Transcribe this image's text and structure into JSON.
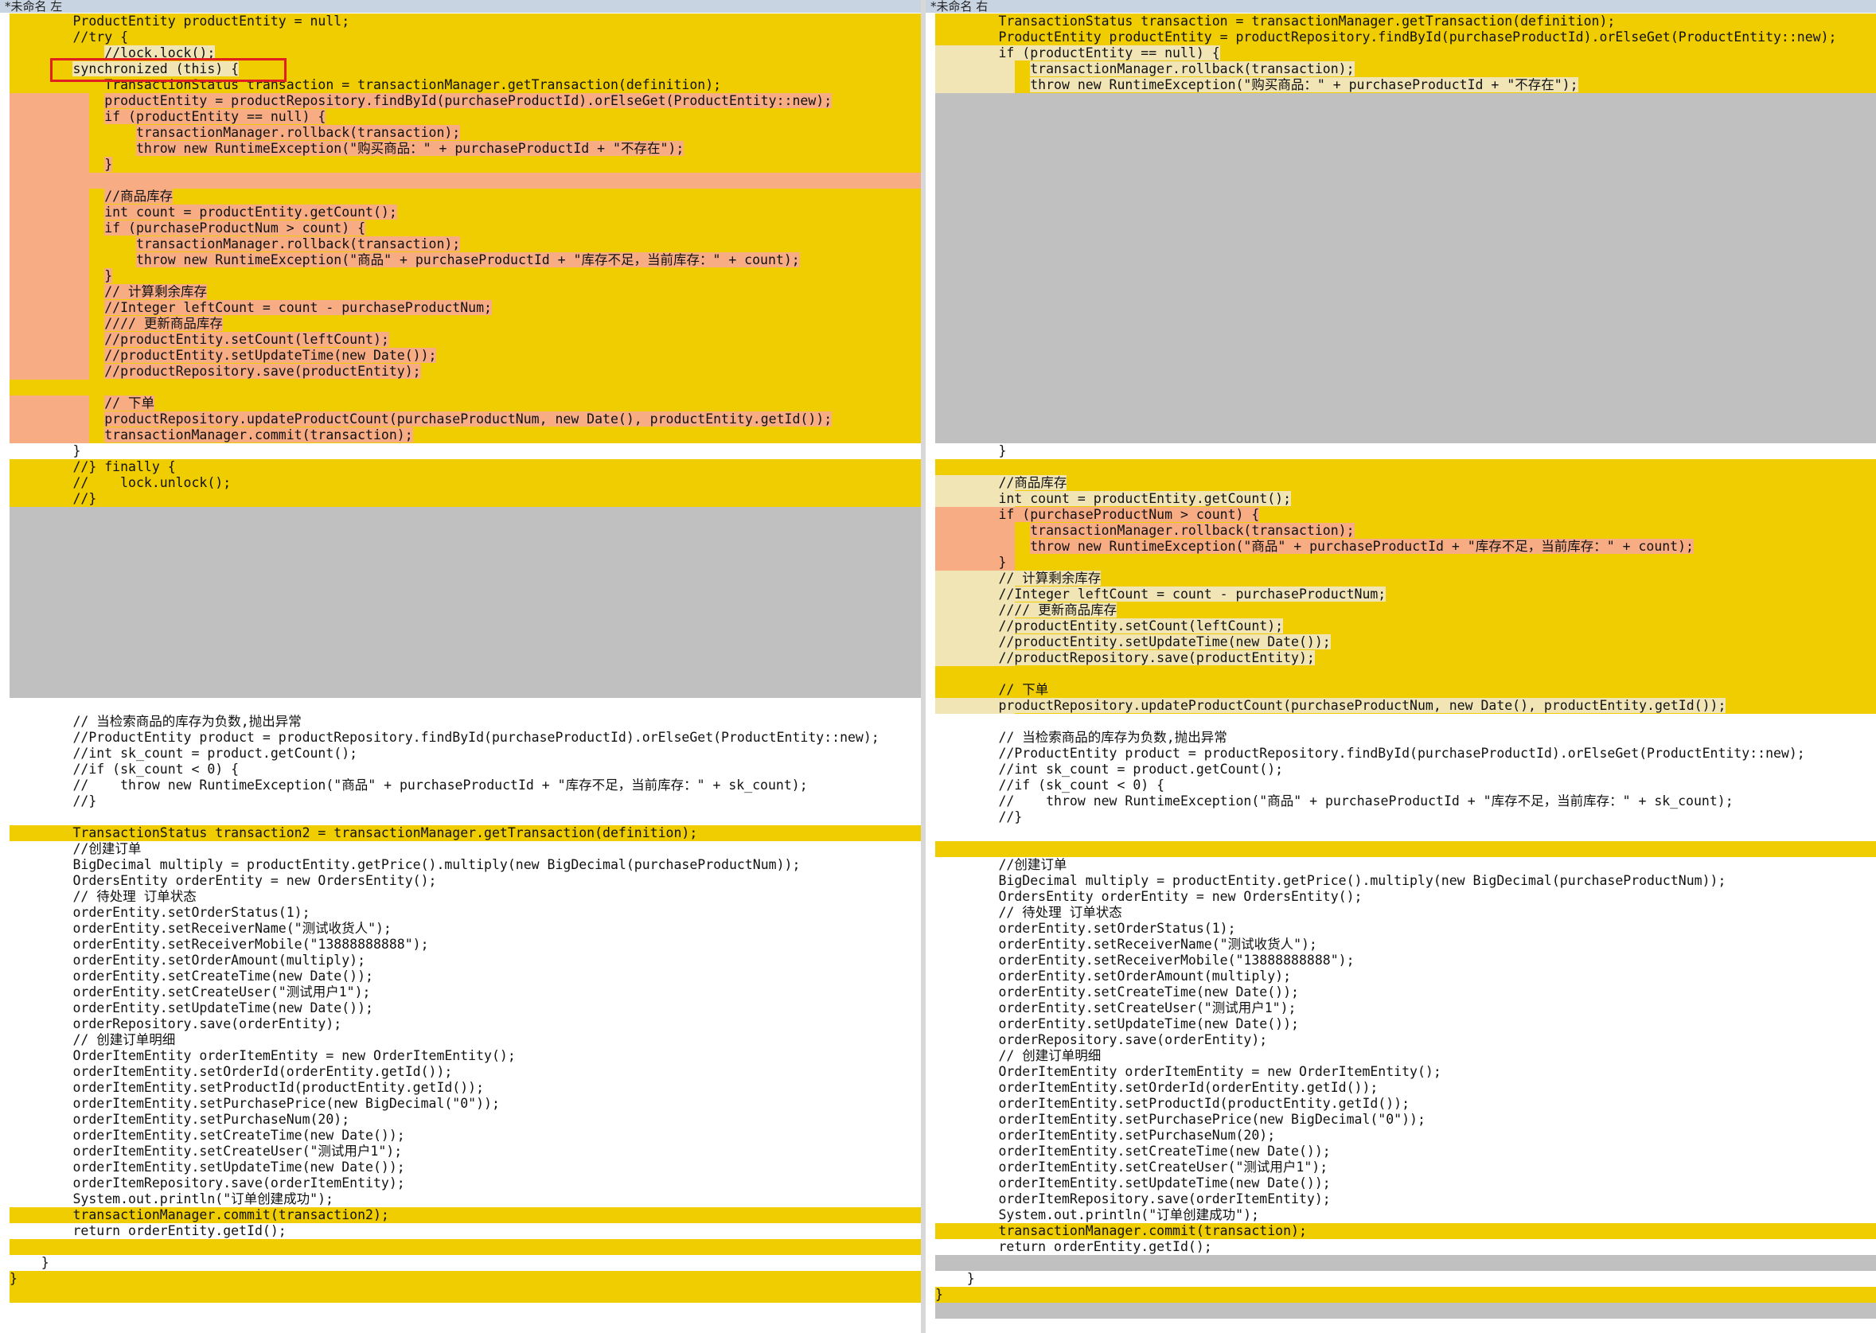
{
  "left_pane": {
    "title": "*未命名 左",
    "lines": [
      {
        "t": "        ProductEntity productEntity = null;",
        "k": "diff"
      },
      {
        "t": "        //try {",
        "k": "diff"
      },
      {
        "t": "            //lock.lock();",
        "k": "diff",
        "light": true
      },
      {
        "t": "        synchronized (this) {",
        "k": "diff",
        "light": true
      },
      {
        "t": "            TransactionStatus transaction = transactionManager.getTransaction(definition);",
        "k": "diff"
      },
      {
        "t": "            productEntity = productRepository.findById(purchaseProductId).orElseGet(ProductEntity::new);",
        "k": "diff",
        "strong": true
      },
      {
        "t": "            if (productEntity == null) {",
        "k": "diff",
        "strong": true
      },
      {
        "t": "                transactionManager.rollback(transaction);",
        "k": "diff",
        "strong": true
      },
      {
        "t": "                throw new RuntimeException(\"购买商品：\" + purchaseProductId + \"不存在\");",
        "k": "diff",
        "strong": true
      },
      {
        "t": "            }",
        "k": "diff",
        "strong": true
      },
      {
        "t": "",
        "k": "diff",
        "strong": true
      },
      {
        "t": "            //商品库存",
        "k": "diff",
        "strong": true
      },
      {
        "t": "            int count = productEntity.getCount();",
        "k": "diff",
        "strong": true
      },
      {
        "t": "            if (purchaseProductNum > count) {",
        "k": "diff",
        "strong": true
      },
      {
        "t": "                transactionManager.rollback(transaction);",
        "k": "diff",
        "strong": true
      },
      {
        "t": "                throw new RuntimeException(\"商品\" + purchaseProductId + \"库存不足，当前库存：\" + count);",
        "k": "diff",
        "strong": true
      },
      {
        "t": "            }",
        "k": "diff",
        "strong": true
      },
      {
        "t": "            // 计算剩余库存",
        "k": "diff",
        "strong": true
      },
      {
        "t": "            //Integer leftCount = count - purchaseProductNum;",
        "k": "diff",
        "strong": true
      },
      {
        "t": "            //// 更新商品库存",
        "k": "diff",
        "strong": true
      },
      {
        "t": "            //productEntity.setCount(leftCount);",
        "k": "diff",
        "strong": true
      },
      {
        "t": "            //productEntity.setUpdateTime(new Date());",
        "k": "diff",
        "strong": true
      },
      {
        "t": "            //productRepository.save(productEntity);",
        "k": "diff",
        "strong": true
      },
      {
        "t": "",
        "k": "diff",
        "light": true
      },
      {
        "t": "            // 下单",
        "k": "diff",
        "strong": true
      },
      {
        "t": "            productRepository.updateProductCount(purchaseProductNum, new Date(), productEntity.getId());",
        "k": "diff",
        "strong": true
      },
      {
        "t": "            transactionManager.commit(transaction);",
        "k": "diff",
        "strong": true
      },
      {
        "t": "        }",
        "k": "plain"
      },
      {
        "t": "        //} finally {",
        "k": "diff"
      },
      {
        "t": "        //    lock.unlock();",
        "k": "diff"
      },
      {
        "t": "        //}",
        "k": "diff"
      },
      {
        "t": "",
        "k": "gap"
      },
      {
        "t": "",
        "k": "gap"
      },
      {
        "t": "",
        "k": "gap"
      },
      {
        "t": "",
        "k": "gap"
      },
      {
        "t": "",
        "k": "gap"
      },
      {
        "t": "",
        "k": "gap"
      },
      {
        "t": "",
        "k": "gap"
      },
      {
        "t": "",
        "k": "gap"
      },
      {
        "t": "",
        "k": "gap"
      },
      {
        "t": "",
        "k": "gap"
      },
      {
        "t": "",
        "k": "gap"
      },
      {
        "t": "",
        "k": "gap"
      },
      {
        "t": "",
        "k": "plain"
      },
      {
        "t": "        // 当检索商品的库存为负数,抛出异常",
        "k": "plain"
      },
      {
        "t": "        //ProductEntity product = productRepository.findById(purchaseProductId).orElseGet(ProductEntity::new);",
        "k": "plain"
      },
      {
        "t": "        //int sk_count = product.getCount();",
        "k": "plain"
      },
      {
        "t": "        //if (sk_count < 0) {",
        "k": "plain"
      },
      {
        "t": "        //    throw new RuntimeException(\"商品\" + purchaseProductId + \"库存不足，当前库存：\" + sk_count);",
        "k": "plain"
      },
      {
        "t": "        //}",
        "k": "plain"
      },
      {
        "t": "",
        "k": "plain"
      },
      {
        "t": "        TransactionStatus transaction2 = transactionManager.getTransaction(definition);",
        "k": "diff"
      },
      {
        "t": "        //创建订单",
        "k": "plain"
      },
      {
        "t": "        BigDecimal multiply = productEntity.getPrice().multiply(new BigDecimal(purchaseProductNum));",
        "k": "plain"
      },
      {
        "t": "        OrdersEntity orderEntity = new OrdersEntity();",
        "k": "plain"
      },
      {
        "t": "        // 待处理 订单状态",
        "k": "plain"
      },
      {
        "t": "        orderEntity.setOrderStatus(1);",
        "k": "plain"
      },
      {
        "t": "        orderEntity.setReceiverName(\"测试收货人\");",
        "k": "plain"
      },
      {
        "t": "        orderEntity.setReceiverMobile(\"13888888888\");",
        "k": "plain"
      },
      {
        "t": "        orderEntity.setOrderAmount(multiply);",
        "k": "plain"
      },
      {
        "t": "        orderEntity.setCreateTime(new Date());",
        "k": "plain"
      },
      {
        "t": "        orderEntity.setCreateUser(\"测试用户1\");",
        "k": "plain"
      },
      {
        "t": "        orderEntity.setUpdateTime(new Date());",
        "k": "plain"
      },
      {
        "t": "        orderRepository.save(orderEntity);",
        "k": "plain"
      },
      {
        "t": "        // 创建订单明细",
        "k": "plain"
      },
      {
        "t": "        OrderItemEntity orderItemEntity = new OrderItemEntity();",
        "k": "plain"
      },
      {
        "t": "        orderItemEntity.setOrderId(orderEntity.getId());",
        "k": "plain"
      },
      {
        "t": "        orderItemEntity.setProductId(productEntity.getId());",
        "k": "plain"
      },
      {
        "t": "        orderItemEntity.setPurchasePrice(new BigDecimal(\"0\"));",
        "k": "plain"
      },
      {
        "t": "        orderItemEntity.setPurchaseNum(20);",
        "k": "plain"
      },
      {
        "t": "        orderItemEntity.setCreateTime(new Date());",
        "k": "plain"
      },
      {
        "t": "        orderItemEntity.setCreateUser(\"测试用户1\");",
        "k": "plain"
      },
      {
        "t": "        orderItemEntity.setUpdateTime(new Date());",
        "k": "plain"
      },
      {
        "t": "        orderItemRepository.save(orderItemEntity);",
        "k": "plain"
      },
      {
        "t": "        System.out.println(\"订单创建成功\");",
        "k": "plain"
      },
      {
        "t": "        transactionManager.commit(transaction2);",
        "k": "diff"
      },
      {
        "t": "        return orderEntity.getId();",
        "k": "plain"
      },
      {
        "t": "",
        "k": "diff"
      },
      {
        "t": "    }",
        "k": "plain"
      },
      {
        "t": "}",
        "k": "diff"
      },
      {
        "t": "",
        "k": "diff"
      }
    ]
  },
  "right_pane": {
    "title": "*未命名 右",
    "lines": [
      {
        "t": "        TransactionStatus transaction = transactionManager.getTransaction(definition);",
        "k": "diff"
      },
      {
        "t": "        ProductEntity productEntity = productRepository.findById(purchaseProductId).orElseGet(ProductEntity::new);",
        "k": "diff"
      },
      {
        "t": "        if (productEntity == null) {",
        "k": "diff",
        "light": true
      },
      {
        "t": "            transactionManager.rollback(transaction);",
        "k": "diff",
        "light": true
      },
      {
        "t": "            throw new RuntimeException(\"购买商品：\" + purchaseProductId + \"不存在\");",
        "k": "diff",
        "light": true
      },
      {
        "t": "",
        "k": "gap"
      },
      {
        "t": "",
        "k": "gap"
      },
      {
        "t": "",
        "k": "gap"
      },
      {
        "t": "",
        "k": "gap"
      },
      {
        "t": "",
        "k": "gap"
      },
      {
        "t": "",
        "k": "gap"
      },
      {
        "t": "",
        "k": "gap"
      },
      {
        "t": "",
        "k": "gap"
      },
      {
        "t": "",
        "k": "gap"
      },
      {
        "t": "",
        "k": "gap"
      },
      {
        "t": "",
        "k": "gap"
      },
      {
        "t": "",
        "k": "gap"
      },
      {
        "t": "",
        "k": "gap"
      },
      {
        "t": "",
        "k": "gap"
      },
      {
        "t": "",
        "k": "gap"
      },
      {
        "t": "",
        "k": "gap"
      },
      {
        "t": "",
        "k": "gap"
      },
      {
        "t": "",
        "k": "gap"
      },
      {
        "t": "",
        "k": "gap"
      },
      {
        "t": "",
        "k": "gap"
      },
      {
        "t": "",
        "k": "gap"
      },
      {
        "t": "",
        "k": "gap"
      },
      {
        "t": "        }",
        "k": "plain"
      },
      {
        "t": "",
        "k": "diff"
      },
      {
        "t": "        //商品库存",
        "k": "diff",
        "light": true
      },
      {
        "t": "        int count = productEntity.getCount();",
        "k": "diff",
        "light": true
      },
      {
        "t": "        if (purchaseProductNum > count) {",
        "k": "diff",
        "strong": true
      },
      {
        "t": "            transactionManager.rollback(transaction);",
        "k": "diff",
        "strong": true
      },
      {
        "t": "            throw new RuntimeException(\"商品\" + purchaseProductId + \"库存不足，当前库存：\" + count);",
        "k": "diff",
        "strong": true
      },
      {
        "t": "        }",
        "k": "diff",
        "strong": true
      },
      {
        "t": "        // 计算剩余库存",
        "k": "diff",
        "light": true
      },
      {
        "t": "        //Integer leftCount = count - purchaseProductNum;",
        "k": "diff",
        "light": true
      },
      {
        "t": "        //// 更新商品库存",
        "k": "diff",
        "light": true
      },
      {
        "t": "        //productEntity.setCount(leftCount);",
        "k": "diff",
        "light": true
      },
      {
        "t": "        //productEntity.setUpdateTime(new Date());",
        "k": "diff",
        "light": true
      },
      {
        "t": "        //productRepository.save(productEntity);",
        "k": "diff",
        "light": true
      },
      {
        "t": "",
        "k": "diff"
      },
      {
        "t": "        // 下单",
        "k": "diff"
      },
      {
        "t": "        productRepository.updateProductCount(purchaseProductNum, new Date(), productEntity.getId());",
        "k": "diff",
        "light": true
      },
      {
        "t": "",
        "k": "plain"
      },
      {
        "t": "        // 当检索商品的库存为负数,抛出异常",
        "k": "plain"
      },
      {
        "t": "        //ProductEntity product = productRepository.findById(purchaseProductId).orElseGet(ProductEntity::new);",
        "k": "plain"
      },
      {
        "t": "        //int sk_count = product.getCount();",
        "k": "plain"
      },
      {
        "t": "        //if (sk_count < 0) {",
        "k": "plain"
      },
      {
        "t": "        //    throw new RuntimeException(\"商品\" + purchaseProductId + \"库存不足，当前库存：\" + sk_count);",
        "k": "plain"
      },
      {
        "t": "        //}",
        "k": "plain"
      },
      {
        "t": "",
        "k": "plain"
      },
      {
        "t": "",
        "k": "diff"
      },
      {
        "t": "        //创建订单",
        "k": "plain"
      },
      {
        "t": "        BigDecimal multiply = productEntity.getPrice().multiply(new BigDecimal(purchaseProductNum));",
        "k": "plain"
      },
      {
        "t": "        OrdersEntity orderEntity = new OrdersEntity();",
        "k": "plain"
      },
      {
        "t": "        // 待处理 订单状态",
        "k": "plain"
      },
      {
        "t": "        orderEntity.setOrderStatus(1);",
        "k": "plain"
      },
      {
        "t": "        orderEntity.setReceiverName(\"测试收货人\");",
        "k": "plain"
      },
      {
        "t": "        orderEntity.setReceiverMobile(\"13888888888\");",
        "k": "plain"
      },
      {
        "t": "        orderEntity.setOrderAmount(multiply);",
        "k": "plain"
      },
      {
        "t": "        orderEntity.setCreateTime(new Date());",
        "k": "plain"
      },
      {
        "t": "        orderEntity.setCreateUser(\"测试用户1\");",
        "k": "plain"
      },
      {
        "t": "        orderEntity.setUpdateTime(new Date());",
        "k": "plain"
      },
      {
        "t": "        orderRepository.save(orderEntity);",
        "k": "plain"
      },
      {
        "t": "        // 创建订单明细",
        "k": "plain"
      },
      {
        "t": "        OrderItemEntity orderItemEntity = new OrderItemEntity();",
        "k": "plain"
      },
      {
        "t": "        orderItemEntity.setOrderId(orderEntity.getId());",
        "k": "plain"
      },
      {
        "t": "        orderItemEntity.setProductId(productEntity.getId());",
        "k": "plain"
      },
      {
        "t": "        orderItemEntity.setPurchasePrice(new BigDecimal(\"0\"));",
        "k": "plain"
      },
      {
        "t": "        orderItemEntity.setPurchaseNum(20);",
        "k": "plain"
      },
      {
        "t": "        orderItemEntity.setCreateTime(new Date());",
        "k": "plain"
      },
      {
        "t": "        orderItemEntity.setCreateUser(\"测试用户1\");",
        "k": "plain"
      },
      {
        "t": "        orderItemEntity.setUpdateTime(new Date());",
        "k": "plain"
      },
      {
        "t": "        orderItemRepository.save(orderItemEntity);",
        "k": "plain"
      },
      {
        "t": "        System.out.println(\"订单创建成功\");",
        "k": "plain"
      },
      {
        "t": "        transactionManager.commit(transaction);",
        "k": "diff"
      },
      {
        "t": "        return orderEntity.getId();",
        "k": "plain"
      },
      {
        "t": "",
        "k": "gap"
      },
      {
        "t": "    }",
        "k": "plain"
      },
      {
        "t": "}",
        "k": "diff"
      },
      {
        "t": "",
        "k": "gap"
      }
    ]
  },
  "colors": {
    "diff_line": "#f0cd00",
    "gap_line": "#c0c0c0",
    "strong_highlight": "#f8ac84",
    "light_highlight": "#f1e5b6",
    "callout_border": "#e01f1f"
  }
}
